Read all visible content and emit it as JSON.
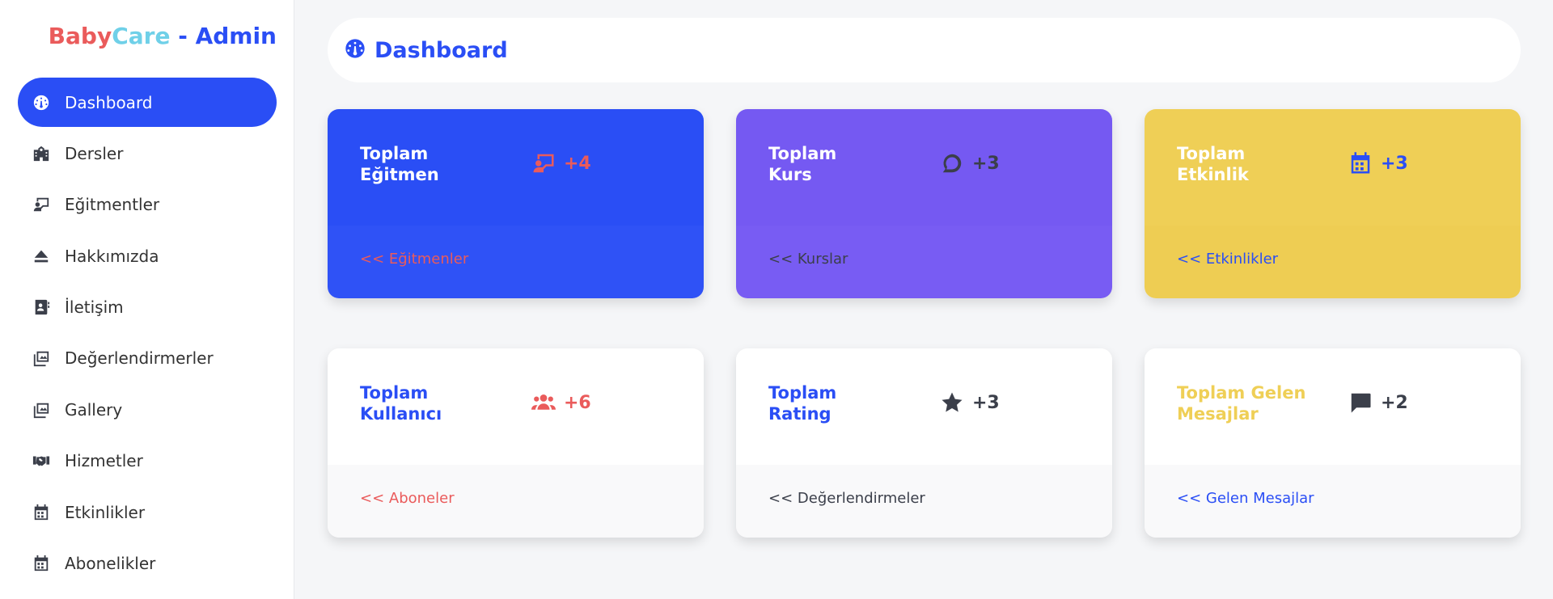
{
  "brand": {
    "part1": "Baby",
    "part2": "Care",
    "part3": " - Admin"
  },
  "sidebar": {
    "items": [
      {
        "label": "Dashboard",
        "icon": "dashboard-icon",
        "active": true
      },
      {
        "label": "Dersler",
        "icon": "school-icon"
      },
      {
        "label": "Eğitmentler",
        "icon": "teacher-icon"
      },
      {
        "label": "Hakkımızda",
        "icon": "eject-icon"
      },
      {
        "label": "İletişim",
        "icon": "contact-card-icon"
      },
      {
        "label": "Değerlendirmerler",
        "icon": "images-icon"
      },
      {
        "label": "Gallery",
        "icon": "images-icon"
      },
      {
        "label": "Hizmetler",
        "icon": "handshake-icon"
      },
      {
        "label": "Etkinlikler",
        "icon": "calendar-icon"
      },
      {
        "label": "Abonelikler",
        "icon": "calendar-icon"
      }
    ]
  },
  "header": {
    "title": "Dashboard",
    "icon": "dashboard-icon"
  },
  "colors": {
    "blue": "#2a4ef5",
    "purple": "#7559f2",
    "yellow": "#efcf56",
    "red": "#ea5b5b",
    "dark": "#3b3f4a"
  },
  "cards": [
    {
      "label_line1": "Toplam",
      "label_line2": "Eğitmen",
      "value": "+4",
      "icon": "teacher-icon",
      "link": "<< Eğitmenler"
    },
    {
      "label_line1": "Toplam",
      "label_line2": "Kurs",
      "value": "+3",
      "icon": "chat-bubble-icon",
      "link": "<< Kurslar"
    },
    {
      "label_line1": "Toplam",
      "label_line2": "Etkinlik",
      "value": "+3",
      "icon": "calendar-icon",
      "link": "<< Etkinlikler"
    },
    {
      "label_line1": "Toplam",
      "label_line2": "Kullanıcı",
      "value": "+6",
      "icon": "users-icon",
      "link": "<< Aboneler"
    },
    {
      "label_line1": "Toplam",
      "label_line2": "Rating",
      "value": "+3",
      "icon": "star-icon",
      "link": "<< Değerlendirmeler"
    },
    {
      "label_line1": "Toplam Gelen",
      "label_line2": "Mesajlar",
      "value": "+2",
      "icon": "message-icon",
      "link": "<< Gelen Mesajlar"
    }
  ]
}
